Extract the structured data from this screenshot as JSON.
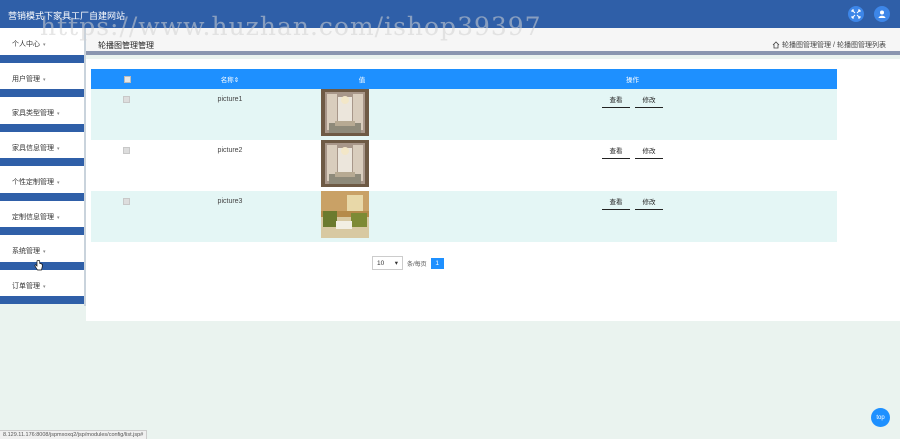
{
  "app": {
    "title": "营销模式下家具工厂自建网站"
  },
  "watermark": "https://www.huzhan.com/ishop39397",
  "sidebar": {
    "items": [
      {
        "label": "个人中心"
      },
      {
        "label": "用户管理"
      },
      {
        "label": "家具类型管理"
      },
      {
        "label": "家具信息管理"
      },
      {
        "label": "个性定制管理"
      },
      {
        "label": "定制信息管理"
      },
      {
        "label": "系统管理"
      },
      {
        "label": "订单管理"
      }
    ]
  },
  "page": {
    "title": "轮播图管理管理",
    "breadcrumb": [
      "轮播图管理管理",
      "轮播图管理列表"
    ],
    "breadcrumb_separator": "/"
  },
  "table": {
    "headers": {
      "name": "名称⇕",
      "value": "值",
      "ops": "操作"
    },
    "rows": [
      {
        "name": "picture1",
        "image": "chandelier-room-photo"
      },
      {
        "name": "picture2",
        "image": "chandelier-room-photo"
      },
      {
        "name": "picture3",
        "image": "living-room-photo"
      }
    ],
    "view_label": "查看",
    "edit_label": "修改"
  },
  "pagination": {
    "page_size": "10",
    "page_size_label": "条/每页",
    "current_page": "1"
  },
  "status_bar": "8.129.11.176:8008/jspmxoxq2/jsp/modules/config/list.jsp#",
  "back_to_top": "top",
  "colors": {
    "topbar": "#2f5fa8",
    "accent": "#1e90ff",
    "row_alt": "#e4f6f5",
    "background": "#eaf3ef"
  }
}
